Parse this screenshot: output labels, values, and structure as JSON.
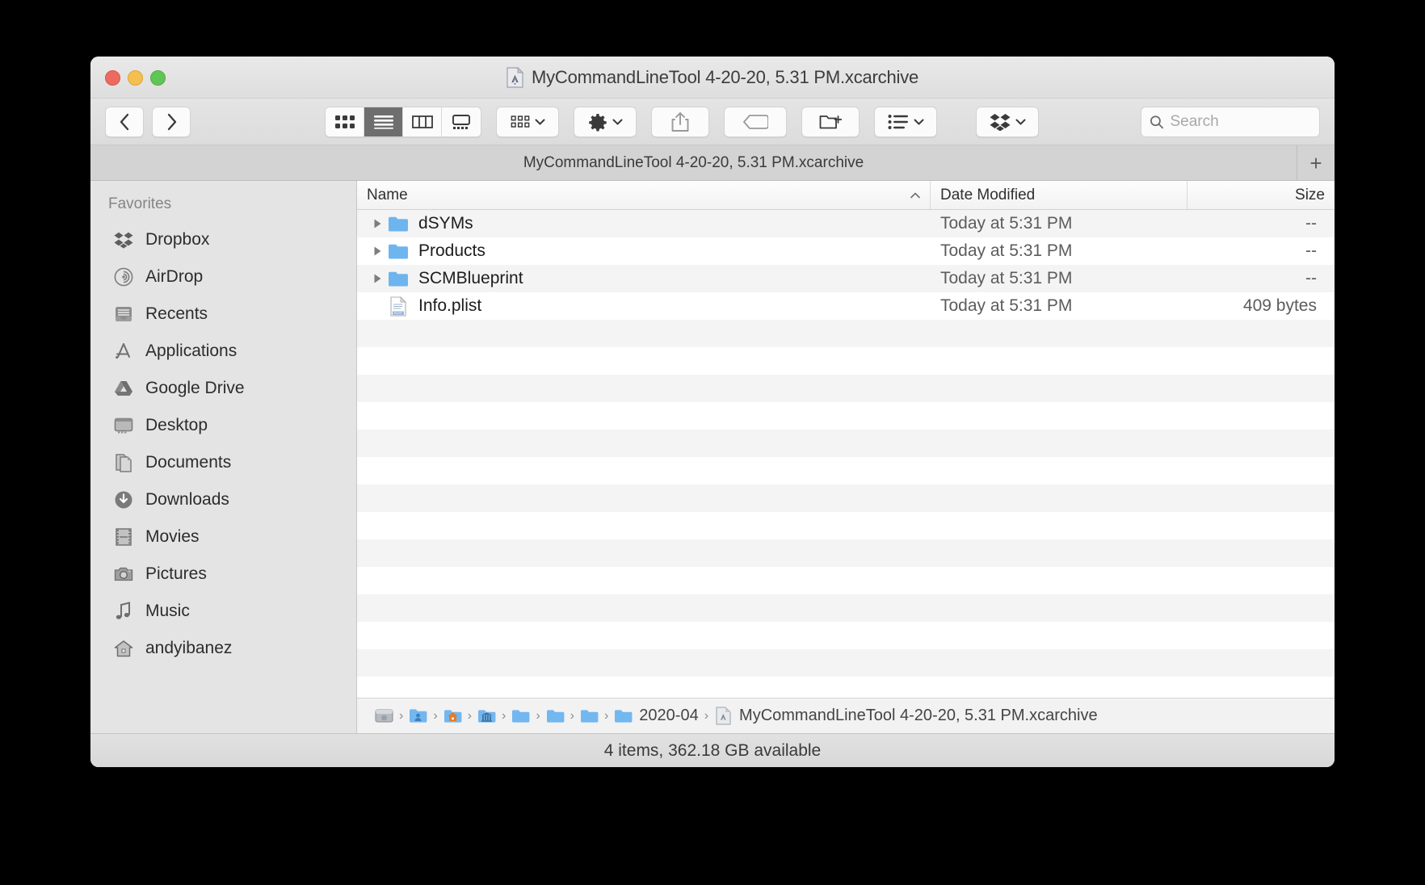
{
  "window": {
    "title": "MyCommandLineTool 4-20-20, 5.31 PM.xcarchive",
    "traffic_lights": {
      "close": "close-button",
      "minimize": "minimize-button",
      "zoom": "zoom-button"
    }
  },
  "toolbar": {
    "back_label": "‹",
    "forward_label": "›",
    "view_modes": [
      {
        "name": "icon-view",
        "active": false
      },
      {
        "name": "list-view",
        "active": true
      },
      {
        "name": "column-view",
        "active": false
      },
      {
        "name": "gallery-view",
        "active": false
      }
    ],
    "arrange_label": "arrange",
    "action_label": "action",
    "share_label": "share",
    "tag_label": "tag",
    "new_folder_label": "new-folder",
    "group_label": "group",
    "dropbox_label": "dropbox"
  },
  "search": {
    "value": "",
    "placeholder": "Search"
  },
  "tabbar": {
    "tabs": [
      {
        "label": "MyCommandLineTool 4-20-20, 5.31 PM.xcarchive",
        "active": true
      }
    ],
    "add_label": "+"
  },
  "sidebar": {
    "section_title": "Favorites",
    "items": [
      {
        "label": "Dropbox",
        "icon": "dropbox-icon"
      },
      {
        "label": "AirDrop",
        "icon": "airdrop-icon"
      },
      {
        "label": "Recents",
        "icon": "recents-icon"
      },
      {
        "label": "Applications",
        "icon": "applications-icon"
      },
      {
        "label": "Google Drive",
        "icon": "google-drive-icon"
      },
      {
        "label": "Desktop",
        "icon": "desktop-icon"
      },
      {
        "label": "Documents",
        "icon": "documents-icon"
      },
      {
        "label": "Downloads",
        "icon": "downloads-icon"
      },
      {
        "label": "Movies",
        "icon": "movies-icon"
      },
      {
        "label": "Pictures",
        "icon": "pictures-icon"
      },
      {
        "label": "Music",
        "icon": "music-icon"
      },
      {
        "label": "andyibanez",
        "icon": "home-icon"
      }
    ]
  },
  "filelist": {
    "columns": {
      "name": "Name",
      "date": "Date Modified",
      "size": "Size"
    },
    "sort_column": "Name",
    "sort_direction": "ascending",
    "rows": [
      {
        "name": "dSYMs",
        "date": "Today at 5:31 PM",
        "size": "--",
        "kind": "folder",
        "expandable": true
      },
      {
        "name": "Products",
        "date": "Today at 5:31 PM",
        "size": "--",
        "kind": "folder",
        "expandable": true
      },
      {
        "name": "SCMBlueprint",
        "date": "Today at 5:31 PM",
        "size": "--",
        "kind": "folder",
        "expandable": true
      },
      {
        "name": "Info.plist",
        "date": "Today at 5:31 PM",
        "size": "409 bytes",
        "kind": "plist",
        "expandable": false
      }
    ]
  },
  "pathbar": {
    "crumbs": [
      {
        "label": "",
        "icon": "hard-drive-icon"
      },
      {
        "label": "",
        "icon": "users-folder-icon"
      },
      {
        "label": "",
        "icon": "home-folder-icon"
      },
      {
        "label": "",
        "icon": "library-folder-icon"
      },
      {
        "label": "",
        "icon": "folder-icon"
      },
      {
        "label": "",
        "icon": "folder-icon"
      },
      {
        "label": "",
        "icon": "folder-icon"
      },
      {
        "label": "2020-04",
        "icon": "folder-icon"
      },
      {
        "label": "MyCommandLineTool 4-20-20, 5.31 PM.xcarchive",
        "icon": "xcarchive-icon"
      }
    ]
  },
  "statusbar": {
    "text": "4 items, 362.18 GB available"
  },
  "colors": {
    "folder_blue": "#6eb5ef",
    "selected_segment": "#6e6e6e",
    "window_chrome": "#e4e4e4",
    "sidebar_bg": "#e4e4e4",
    "row_alt": "#f4f4f4"
  }
}
